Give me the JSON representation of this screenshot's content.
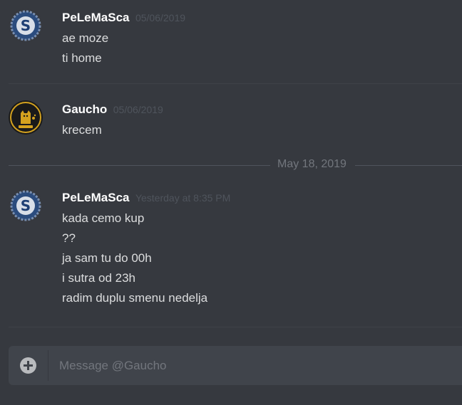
{
  "messages": [
    {
      "author": "PeLeMaSca",
      "timestamp": "05/06/2019",
      "avatar_icon": "sharks-logo-icon",
      "lines": [
        "ae moze",
        "ti home"
      ]
    },
    {
      "author": "Gaucho",
      "timestamp": "05/06/2019",
      "avatar_icon": "cat-logo-icon",
      "lines": [
        "krecem"
      ]
    },
    {
      "author": "PeLeMaSca",
      "timestamp": "Yesterday at 8:35 PM",
      "avatar_icon": "sharks-logo-icon",
      "lines": [
        "kada cemo kup",
        "??",
        "ja sam tu do 00h",
        "i sutra od 23h",
        "radim duplu smenu nedelja"
      ]
    }
  ],
  "date_divider": "May 18, 2019",
  "composer": {
    "placeholder": "Message @Gaucho",
    "value": ""
  },
  "colors": {
    "background": "#36393f",
    "username": "#ffffff",
    "text": "#dcddde",
    "timestamp": "#4f545c",
    "composer_bg": "#40444b"
  }
}
